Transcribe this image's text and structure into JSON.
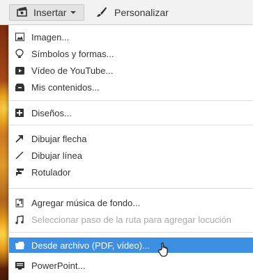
{
  "toolbar": {
    "insert_label": "Insertar",
    "customize_label": "Personalizar"
  },
  "menu": {
    "items": [
      {
        "label": "Imagen...",
        "icon": "image-icon"
      },
      {
        "label": "Símbolos y formas...",
        "icon": "lightbulb-icon"
      },
      {
        "label": "Vídeo de YouTube...",
        "icon": "youtube-play-icon"
      },
      {
        "label": "Mis contenidos...",
        "icon": "inbox-icon"
      },
      {
        "label": "Diseños...",
        "icon": "plus-square-icon"
      },
      {
        "label": "Dibujar flecha",
        "icon": "arrow-icon"
      },
      {
        "label": "Dibujar línea",
        "icon": "line-icon"
      },
      {
        "label": "Rotulador",
        "icon": "marker-icon"
      },
      {
        "label": "Agregar música de fondo...",
        "icon": "music-note-icon"
      },
      {
        "label": "Seleccionar paso de la ruta para agregar locución",
        "icon": "music-note-disabled-icon",
        "disabled": true
      },
      {
        "label": "Desde archivo (PDF, vídeo)...",
        "icon": "folder-icon",
        "selected": true
      },
      {
        "label": "PowerPoint...",
        "icon": "presentation-icon"
      }
    ]
  },
  "colors": {
    "selection": "#3d8fe3",
    "toolbar_bg": "#f2f2f2",
    "disabled_text": "#a9a9a9"
  }
}
